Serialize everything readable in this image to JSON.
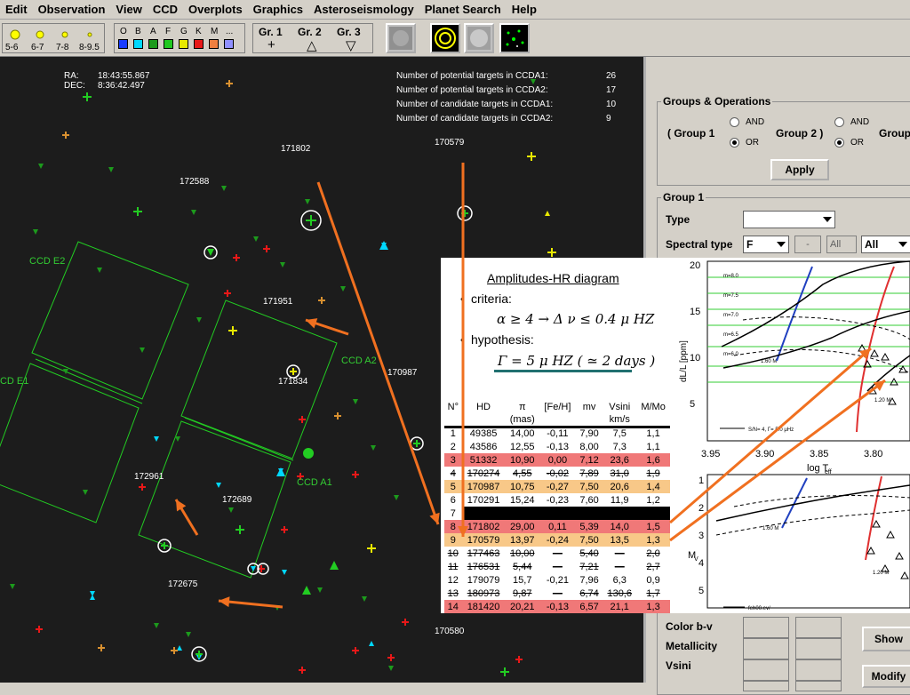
{
  "menu": [
    "Edit",
    "Observation",
    "View",
    "CCD",
    "Overplots",
    "Graphics",
    "Asteroseismology",
    "Planet Search",
    "Help"
  ],
  "toolbar": {
    "magnitudes": [
      "5-6",
      "6-7",
      "7-8",
      "8-9.5"
    ],
    "spectral_types": [
      "O",
      "B",
      "A",
      "F",
      "G",
      "K",
      "M",
      "..."
    ],
    "spectral_colors": [
      "#1a3cff",
      "#00d8ff",
      "#1c9a1c",
      "#20c820",
      "#e8e800",
      "#e81818",
      "#f08040",
      "#9090ff"
    ],
    "groups": [
      {
        "label": "Gr. 1",
        "symbol": "+"
      },
      {
        "label": "Gr. 2",
        "symbol": "△"
      },
      {
        "label": "Gr. 3",
        "symbol": "▽"
      }
    ]
  },
  "sky": {
    "ra_label": "RA:",
    "ra_value": "18:43:55.867",
    "dec_label": "DEC:",
    "dec_value": "8:36:42.497",
    "counts": [
      {
        "label": "Number of potential targets in CCDA1:",
        "value": "26"
      },
      {
        "label": "Number of potential targets in CCDA2:",
        "value": "17"
      },
      {
        "label": "Number of candidate targets in CCDA1:",
        "value": "10"
      },
      {
        "label": "Number of candidate targets in CCDA2:",
        "value": "9"
      }
    ],
    "star_labels": [
      "171802",
      "170579",
      "172588",
      "171951",
      "171834",
      "170987",
      "172961",
      "172689",
      "172675",
      "170580"
    ],
    "ccd_labels": [
      "CCD E2",
      "CCD E1",
      "CCD A2",
      "CCD A1"
    ]
  },
  "panel": {
    "groups_ops_title": "Groups & Operations",
    "group1_paren": "( Group 1",
    "group2_paren": "Group 2 )",
    "group3": "Group",
    "and_label": "AND",
    "or_label": "OR",
    "apply_label": "Apply",
    "group1_title": "Group 1",
    "type_label": "Type",
    "spectral_type_label": "Spectral type",
    "spectral_type_value": "F",
    "dash_value": "-",
    "all_value": "All",
    "all_combo": "All",
    "color_bv_label": "Color b-v",
    "metallicity_label": "Metallicity",
    "vsini_label": "Vsini",
    "show_label": "Show",
    "modify_label": "Modify"
  },
  "overlay": {
    "title": "Amplitudes-HR diagram",
    "criteria_label": "criteria:",
    "criteria_formula": "α ≥ 4 → Δ ν ≤ 0.4 μ HZ",
    "hypothesis_label": "hypothesis:",
    "hypothesis_formula": "Γ = 5 μ HZ ( ≃ 2   days )",
    "table_headers": [
      "N°",
      "HD",
      "π",
      "[Fe/H]",
      "mv",
      "Vsini",
      "M/Mo"
    ],
    "table_subheaders": [
      "",
      "",
      "(mas)",
      "",
      "",
      "km/s",
      ""
    ],
    "table_rows": [
      {
        "n": "1",
        "hd": "49385",
        "pi": "14,00",
        "feh": "-0,11",
        "mv": "7,90",
        "vsini": "7,5",
        "m": "1,1",
        "style": ""
      },
      {
        "n": "2",
        "hd": "43586",
        "pi": "12,55",
        "feh": "-0,13",
        "mv": "8,00",
        "vsini": "7,3",
        "m": "1,1",
        "style": ""
      },
      {
        "n": "3",
        "hd": "51332",
        "pi": "10,90",
        "feh": "0,00",
        "mv": "7,12",
        "vsini": "23,6",
        "m": "1,6",
        "style": "red"
      },
      {
        "n": "4",
        "hd": "170274",
        "pi": "4,55",
        "feh": "-0,02",
        "mv": "7,89",
        "vsini": "31,0",
        "m": "1,9",
        "style": "strike"
      },
      {
        "n": "5",
        "hd": "170987",
        "pi": "10,75",
        "feh": "-0,27",
        "mv": "7,50",
        "vsini": "20,6",
        "m": "1,4",
        "style": "orange"
      },
      {
        "n": "6",
        "hd": "170291",
        "pi": "15,24",
        "feh": "-0,23",
        "mv": "7,60",
        "vsini": "11,9",
        "m": "1,2",
        "style": ""
      },
      {
        "n": "7",
        "hd": "",
        "pi": "",
        "feh": "",
        "mv": "",
        "vsini": "",
        "m": "",
        "style": "black"
      },
      {
        "n": "8",
        "hd": "171802",
        "pi": "29,00",
        "feh": "0,11",
        "mv": "5,39",
        "vsini": "14,0",
        "m": "1,5",
        "style": "red"
      },
      {
        "n": "9",
        "hd": "170579",
        "pi": "13,97",
        "feh": "-0,24",
        "mv": "7,50",
        "vsini": "13,5",
        "m": "1,3",
        "style": "orange"
      },
      {
        "n": "10",
        "hd": "177463",
        "pi": "10,00",
        "feh": "—",
        "mv": "5,40",
        "vsini": "—",
        "m": "2,0",
        "style": "strike"
      },
      {
        "n": "11",
        "hd": "176531",
        "pi": "5,44",
        "feh": "—",
        "mv": "7,21",
        "vsini": "—",
        "m": "2,7",
        "style": "strike"
      },
      {
        "n": "12",
        "hd": "179079",
        "pi": "15,7",
        "feh": "-0,21",
        "mv": "7,96",
        "vsini": "6,3",
        "m": "0,9",
        "style": ""
      },
      {
        "n": "13",
        "hd": "180973",
        "pi": "9,87",
        "feh": "—",
        "mv": "6,74",
        "vsini": "130,6",
        "m": "1,7",
        "style": "strike"
      },
      {
        "n": "14",
        "hd": "181420",
        "pi": "20,21",
        "feh": "-0,13",
        "mv": "6,57",
        "vsini": "21,1",
        "m": "1,3",
        "style": "red"
      }
    ],
    "plot_top": {
      "ylabel": "dL/L [ppm]",
      "yticks": [
        "20",
        "15",
        "10",
        "5"
      ],
      "xticks": [
        "3.95",
        "3.90",
        "3.85",
        "3.80"
      ],
      "xlabel": "log T",
      "xlabel_sub": "eff",
      "legend": "S/N= 4, Γ= 5.0 μHz",
      "line_labels": [
        "m=8.0",
        "m=7.5",
        "m=7.0",
        "m=6.5",
        "m=6.0"
      ],
      "mass_labels": [
        "1.60 M",
        "1.20 M"
      ]
    },
    "plot_bottom": {
      "ylabel": "M",
      "ylabel_sub": "V",
      "yticks": [
        "1",
        "2",
        "3",
        "4",
        "5"
      ],
      "legend": "feh00.ev/",
      "mass_labels": [
        "1.60 M",
        "1.20 M"
      ]
    }
  }
}
